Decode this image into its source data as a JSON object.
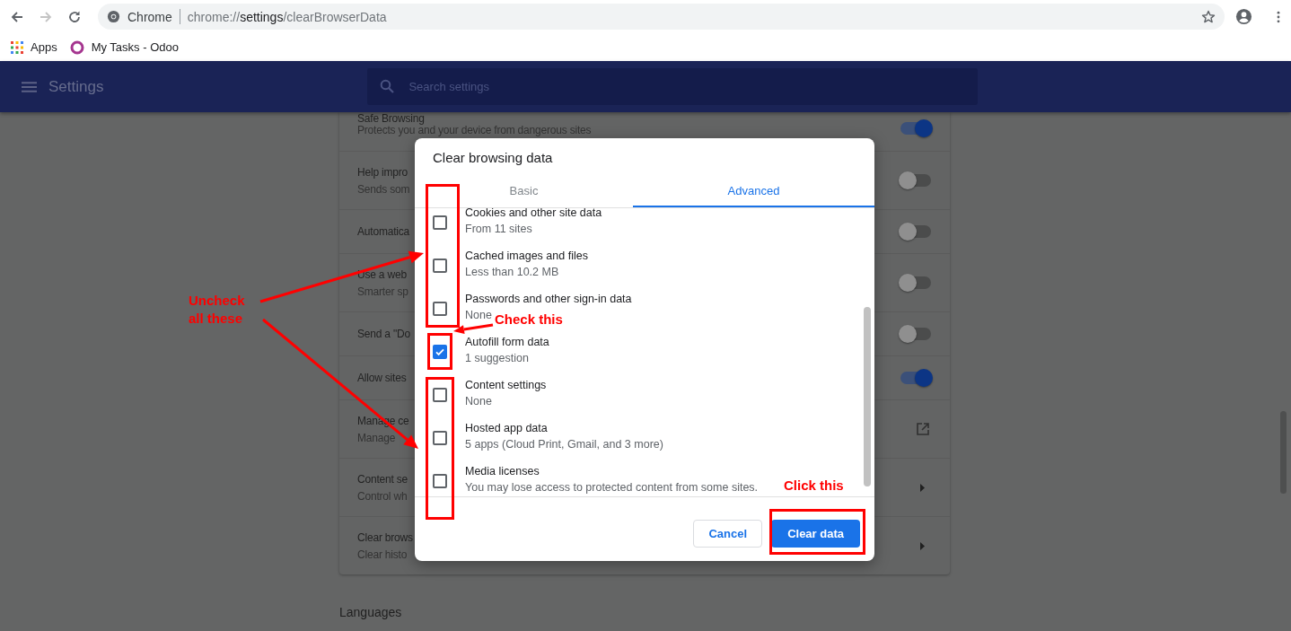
{
  "browser": {
    "nav": [
      {
        "kind": "back",
        "disabled": false
      },
      {
        "kind": "forward",
        "disabled": true
      },
      {
        "kind": "reload",
        "disabled": false
      }
    ],
    "site_label": "Chrome",
    "url": {
      "scheme": "chrome://",
      "host": "settings",
      "path": "/clearBrowserData"
    }
  },
  "bookmarks": [
    {
      "label": "Apps",
      "kind": "apps"
    },
    {
      "label": "My Tasks - Odoo",
      "kind": "ring"
    }
  ],
  "settings_header": {
    "title": "Settings",
    "search": {
      "placeholder": "Search settings"
    }
  },
  "settings_rows": [
    {
      "title": "Safe Browsing",
      "subtitle": "Protects you and your device from dangerous sites",
      "kind": "toggle",
      "on": true
    },
    {
      "title": "Help impro",
      "subtitle": "Sends som",
      "kind": "toggle",
      "on": false
    },
    {
      "title": "Automatica",
      "kind": "toggle",
      "on": false
    },
    {
      "title": "Use a web",
      "subtitle": "Smarter sp",
      "kind": "toggle",
      "on": false
    },
    {
      "title": "Send a \"Do",
      "kind": "toggle",
      "on": false
    },
    {
      "title": "Allow sites",
      "kind": "toggle",
      "on": true
    },
    {
      "title": "Manage ce",
      "subtitle": "Manage",
      "kind": "external"
    },
    {
      "title": "Content se",
      "subtitle": "Control wh",
      "kind": "arrow"
    },
    {
      "title": "Clear brows",
      "subtitle": "Clear histo",
      "kind": "arrow"
    }
  ],
  "section_heading": "Languages",
  "dialog": {
    "title": "Clear browsing data",
    "tabs": [
      {
        "label": "Basic",
        "selected": false
      },
      {
        "label": "Advanced",
        "selected": true
      }
    ],
    "items": [
      {
        "label": "Cookies and other site data",
        "detail": "From 11 sites",
        "checked": false
      },
      {
        "label": "Cached images and files",
        "detail": "Less than 10.2 MB",
        "checked": false
      },
      {
        "label": "Passwords and other sign-in data",
        "detail": "None",
        "checked": false
      },
      {
        "label": "Autofill form data",
        "detail": "1 suggestion",
        "checked": true
      },
      {
        "label": "Content settings",
        "detail": "None",
        "checked": false
      },
      {
        "label": "Hosted app data",
        "detail": "5 apps (Cloud Print, Gmail, and 3 more)",
        "checked": false
      },
      {
        "label": "Media licenses",
        "detail": "You may lose access to protected content from some sites.",
        "checked": false
      }
    ],
    "buttons": [
      {
        "label": "Cancel",
        "kind": "secondary"
      },
      {
        "label": "Clear data",
        "kind": "primary"
      }
    ]
  },
  "annotations": [
    {
      "text": "Uncheck all these"
    },
    {
      "text": "Check this"
    },
    {
      "text": "Click this"
    }
  ]
}
